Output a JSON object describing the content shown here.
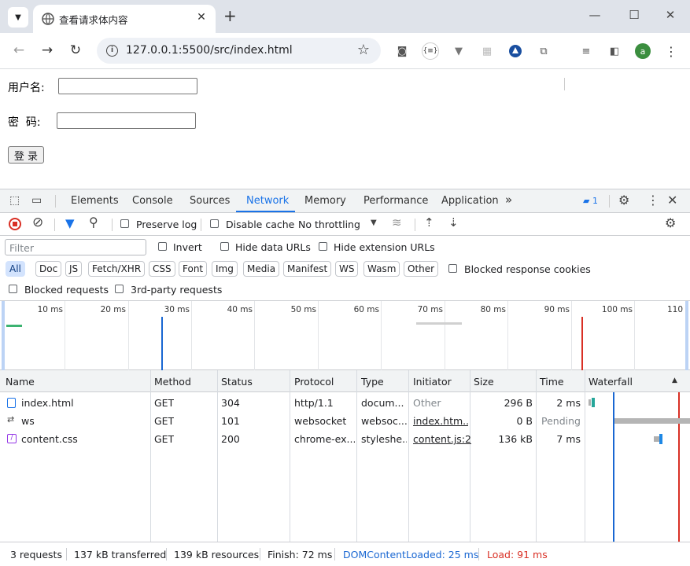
{
  "browser": {
    "tab_title": "查看请求体内容",
    "url": "127.0.0.1:5500/src/index.html",
    "avatar_letter": "a",
    "extension_json_label": "{≡}"
  },
  "page": {
    "username_label": "用户名:",
    "password_label": "密  码:",
    "login_label": "登 录"
  },
  "devtools": {
    "tabs": [
      "Elements",
      "Console",
      "Sources",
      "Network",
      "Memory",
      "Performance",
      "Application"
    ],
    "active_tab": "Network",
    "more_tabs": "»",
    "issues_count": "1",
    "toolbar": {
      "preserve_log": "Preserve log",
      "disable_cache": "Disable cache",
      "throttling": "No throttling"
    },
    "filter": {
      "placeholder": "Filter",
      "invert": "Invert",
      "hide_data_urls": "Hide data URLs",
      "hide_extension_urls": "Hide extension URLs",
      "chips": [
        "All",
        "Doc",
        "JS",
        "Fetch/XHR",
        "CSS",
        "Font",
        "Img",
        "Media",
        "Manifest",
        "WS",
        "Wasm",
        "Other"
      ],
      "blocked_response_cookies": "Blocked response cookies",
      "blocked_requests": "Blocked requests",
      "third_party": "3rd-party requests"
    },
    "overview_ticks": [
      "10 ms",
      "20 ms",
      "30 ms",
      "40 ms",
      "50 ms",
      "60 ms",
      "70 ms",
      "80 ms",
      "90 ms",
      "100 ms",
      "110"
    ],
    "columns": [
      "Name",
      "Method",
      "Status",
      "Protocol",
      "Type",
      "Initiator",
      "Size",
      "Time",
      "Waterfall"
    ],
    "requests": [
      {
        "name": "index.html",
        "method": "GET",
        "status": "304",
        "protocol": "http/1.1",
        "type": "docum...",
        "initiator": "Other",
        "size": "296 B",
        "time": "2 ms"
      },
      {
        "name": "ws",
        "method": "GET",
        "status": "101",
        "protocol": "websocket",
        "type": "websoc...",
        "initiator": "index.htm...",
        "size": "0 B",
        "time": "Pending"
      },
      {
        "name": "content.css",
        "method": "GET",
        "status": "200",
        "protocol": "chrome-ex...",
        "type": "styleshe...",
        "initiator": "content.js:2",
        "size": "136 kB",
        "time": "7 ms"
      }
    ],
    "status_bar": {
      "requests": "3 requests",
      "transferred": "137 kB transferred",
      "resources": "139 kB resources",
      "finish": "Finish: 72 ms",
      "dom_content_loaded": "DOMContentLoaded: 25 ms",
      "load": "Load: 91 ms"
    },
    "colors": {
      "accent": "#1a73e8",
      "dcl": "#1967d2",
      "load": "#d93025"
    }
  }
}
